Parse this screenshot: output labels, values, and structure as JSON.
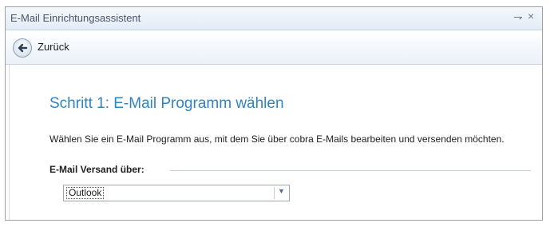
{
  "window": {
    "title": "E-Mail Einrichtungsassistent",
    "pin_glyph": "⇁",
    "close_glyph": "×"
  },
  "nav": {
    "back_label": "Zurück",
    "back_icon": "back-arrow-icon"
  },
  "content": {
    "heading": "Schritt 1: E-Mail Programm wählen",
    "description": "Wählen Sie ein E-Mail Programm aus, mit dem Sie über cobra E-Mails bearbeiten und versenden möchten.",
    "group_label": "E-Mail Versand über:",
    "mail_program": {
      "selected": "Outlook"
    }
  },
  "colors": {
    "accent_heading": "#2f84c4",
    "border": "#a0a0a0"
  }
}
